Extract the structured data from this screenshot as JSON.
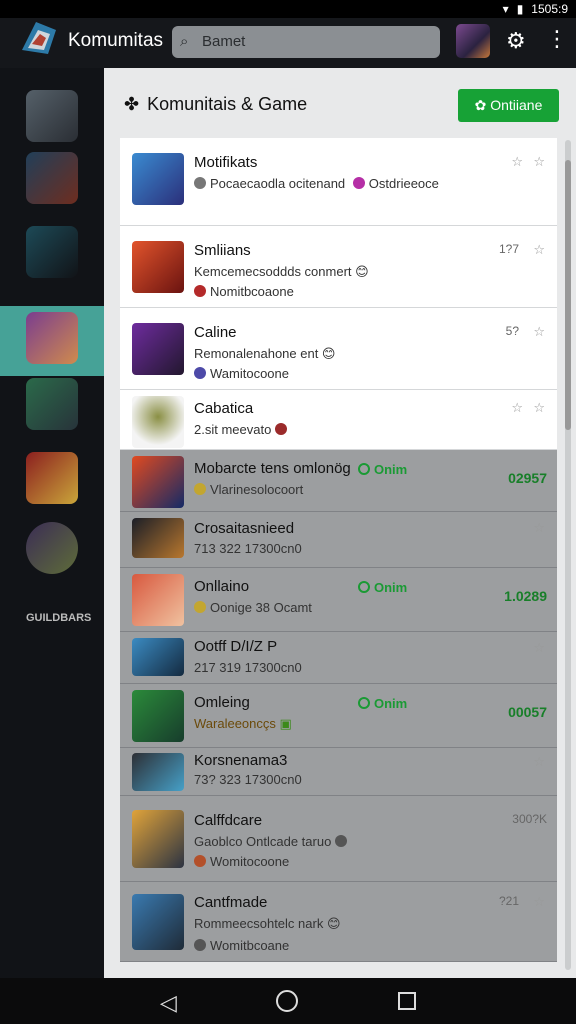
{
  "status_bar": {
    "time": "1505:9"
  },
  "app_bar": {
    "title": "Komumitas",
    "search_placeholder": "Bamet"
  },
  "header": {
    "title": "Komunitais & Game",
    "online_button": "Ontiiane"
  },
  "cards": [
    {
      "title": "Motifikats",
      "line2": "Pocaecaodla ocitenand",
      "line2b": "Ostdrieeoce",
      "line3": "",
      "meta": "",
      "type": "white"
    },
    {
      "title": "Smliians",
      "line2": "Kemcemecsoddds conmert 😊",
      "line3": "Nomitbcoaone",
      "meta": "1?7",
      "type": "white"
    },
    {
      "title": "Caline",
      "line2": "Remonalenahone ent 😊",
      "line3": "Wamitocoone",
      "meta": "5?",
      "type": "white"
    },
    {
      "title": "Cabatica",
      "line2": "2.sit meevato",
      "line3": "",
      "meta": "",
      "type": "white"
    },
    {
      "title": "Mobarcte tens omlonög",
      "line2": "Vlarinesolocoort",
      "status": "Onim",
      "num": "02957",
      "type": "gray"
    },
    {
      "title": "Crosaitasnieed",
      "line2": "713 322 17300cn0",
      "type": "gray"
    },
    {
      "title": "Onllaino",
      "line2": "Oonige 38 Ocamt",
      "status": "Onim",
      "num": "1.0289",
      "type": "gray"
    },
    {
      "title": "Ootff D/I/Z P",
      "line2": "217 319 17300cn0",
      "type": "gray"
    },
    {
      "title": "Omleing",
      "line2": "Waraleeoncçs",
      "status": "Onim",
      "num": "00057",
      "type": "gray"
    },
    {
      "title": "Korsnenama3",
      "line2": "73? 323 17300cn0",
      "type": "gray"
    },
    {
      "title": "Calffdcare",
      "line2": "Gaoblco Ontlcade taruo",
      "line3": "Womitocoone",
      "meta": "300?K",
      "type": "gray"
    },
    {
      "title": "Cantfmade",
      "line2": "Rommeecsohtelc nark 😊",
      "line3": "Womitbcoane",
      "meta": "?21",
      "type": "gray"
    }
  ],
  "sidebar_brand": "GUILDBARS",
  "colors": {
    "accent": "#46a297",
    "online": "#17a236"
  }
}
